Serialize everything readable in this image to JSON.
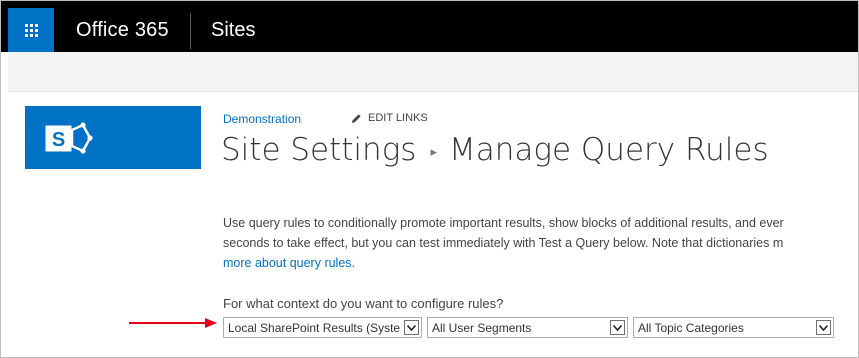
{
  "suite": {
    "brand": "Office 365",
    "app": "Sites"
  },
  "site": {
    "name": "Demonstration",
    "edit_links": "EDIT LINKS"
  },
  "page": {
    "crumb_parent": "Site Settings",
    "crumb_current": "Manage Query Rules",
    "description_line1": "Use query rules to conditionally promote important results, show blocks of additional results, and ever",
    "description_line2": "seconds to take effect, but you can test immediately with Test a Query below. Note that dictionaries m",
    "learn_more": "more about query rules."
  },
  "context": {
    "label": "For what context do you want to configure rules?",
    "result_source": "Local SharePoint Results (Syste",
    "user_segment": "All User Segments",
    "topic_category": "All Topic Categories"
  },
  "colors": {
    "suite_bg": "#000000",
    "accent": "#0072c6",
    "arrow": "#e3001b"
  },
  "icons": {
    "launcher": "waffle-icon",
    "logo": "sharepoint-logo",
    "edit": "pencil-icon",
    "dropdown": "chevron-down-icon",
    "annotation": "red-arrow"
  }
}
